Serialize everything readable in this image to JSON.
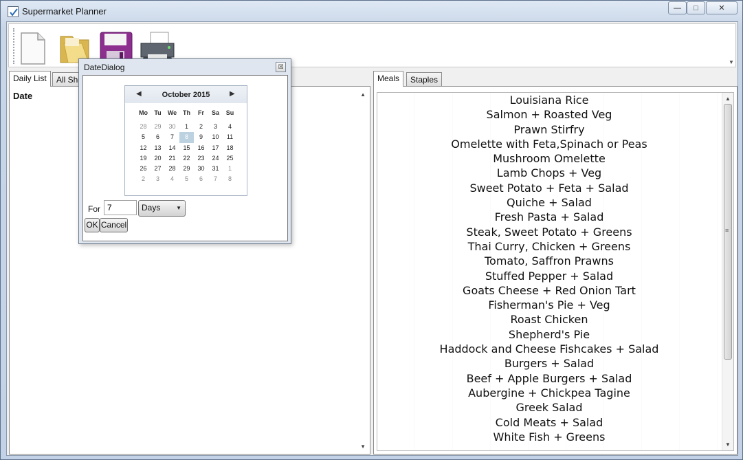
{
  "window": {
    "title": "Supermarket Planner",
    "minimize_glyph": "—",
    "maximize_glyph": "□",
    "close_glyph": "✕"
  },
  "toolbar": {
    "buttons": [
      {
        "id": "new",
        "icon": "new-file-icon"
      },
      {
        "id": "open",
        "icon": "open-folder-icon"
      },
      {
        "id": "save",
        "icon": "save-disk-icon"
      },
      {
        "id": "print",
        "icon": "printer-icon"
      }
    ]
  },
  "left_tabs": {
    "daily": "Daily List",
    "all": "All Sho"
  },
  "left_panel": {
    "date_label": "Date"
  },
  "right_tabs": {
    "meals": "Meals",
    "staples": "Staples"
  },
  "meals": [
    "Louisiana Rice",
    "Salmon + Roasted Veg",
    "Prawn Stirfry",
    "Omelette with Feta,Spinach or Peas",
    "Mushroom Omelette",
    "Lamb Chops + Veg",
    "Sweet Potato + Feta + Salad",
    "Quiche + Salad",
    "Fresh Pasta + Salad",
    "Steak, Sweet Potato + Greens",
    "Thai Curry, Chicken + Greens",
    "Tomato, Saffron Prawns",
    "Stuffed Pepper + Salad",
    "Goats Cheese + Red Onion Tart",
    "Fisherman's Pie + Veg",
    "Roast Chicken",
    "Shepherd's Pie",
    "Haddock and Cheese Fishcakes + Salad",
    "Burgers + Salad",
    "Beef + Apple Burgers + Salad",
    "Aubergine + Chickpea Tagine",
    "Greek Salad",
    "Cold Meats + Salad",
    "White Fish + Greens"
  ],
  "dialog": {
    "title": "DateDialog",
    "close_glyph": "☒",
    "calendar": {
      "month_label": "October 2015",
      "prev_glyph": "◀",
      "next_glyph": "▶",
      "weekdays": [
        "Mo",
        "Tu",
        "We",
        "Th",
        "Fr",
        "Sa",
        "Su"
      ],
      "weeks": [
        [
          {
            "d": "28",
            "m": true
          },
          {
            "d": "29",
            "m": true
          },
          {
            "d": "30",
            "m": true
          },
          {
            "d": "1"
          },
          {
            "d": "2"
          },
          {
            "d": "3"
          },
          {
            "d": "4"
          }
        ],
        [
          {
            "d": "5"
          },
          {
            "d": "6"
          },
          {
            "d": "7"
          },
          {
            "d": "8",
            "today": true
          },
          {
            "d": "9"
          },
          {
            "d": "10"
          },
          {
            "d": "11"
          }
        ],
        [
          {
            "d": "12"
          },
          {
            "d": "13"
          },
          {
            "d": "14"
          },
          {
            "d": "15"
          },
          {
            "d": "16"
          },
          {
            "d": "17"
          },
          {
            "d": "18"
          }
        ],
        [
          {
            "d": "19"
          },
          {
            "d": "20"
          },
          {
            "d": "21"
          },
          {
            "d": "22"
          },
          {
            "d": "23"
          },
          {
            "d": "24"
          },
          {
            "d": "25"
          }
        ],
        [
          {
            "d": "26"
          },
          {
            "d": "27"
          },
          {
            "d": "28"
          },
          {
            "d": "29"
          },
          {
            "d": "30"
          },
          {
            "d": "31"
          },
          {
            "d": "1",
            "m": true
          }
        ],
        [
          {
            "d": "2",
            "m": true
          },
          {
            "d": "3",
            "m": true
          },
          {
            "d": "4",
            "m": true
          },
          {
            "d": "5",
            "m": true
          },
          {
            "d": "6",
            "m": true
          },
          {
            "d": "7",
            "m": true
          },
          {
            "d": "8",
            "m": true
          }
        ]
      ]
    },
    "for_label": "For",
    "days_value": "7",
    "unit_selected": "Days",
    "ok_label": "OK",
    "cancel_label": "Cancel"
  },
  "scroll": {
    "up": "▲",
    "down": "▼",
    "grip": "≡"
  }
}
